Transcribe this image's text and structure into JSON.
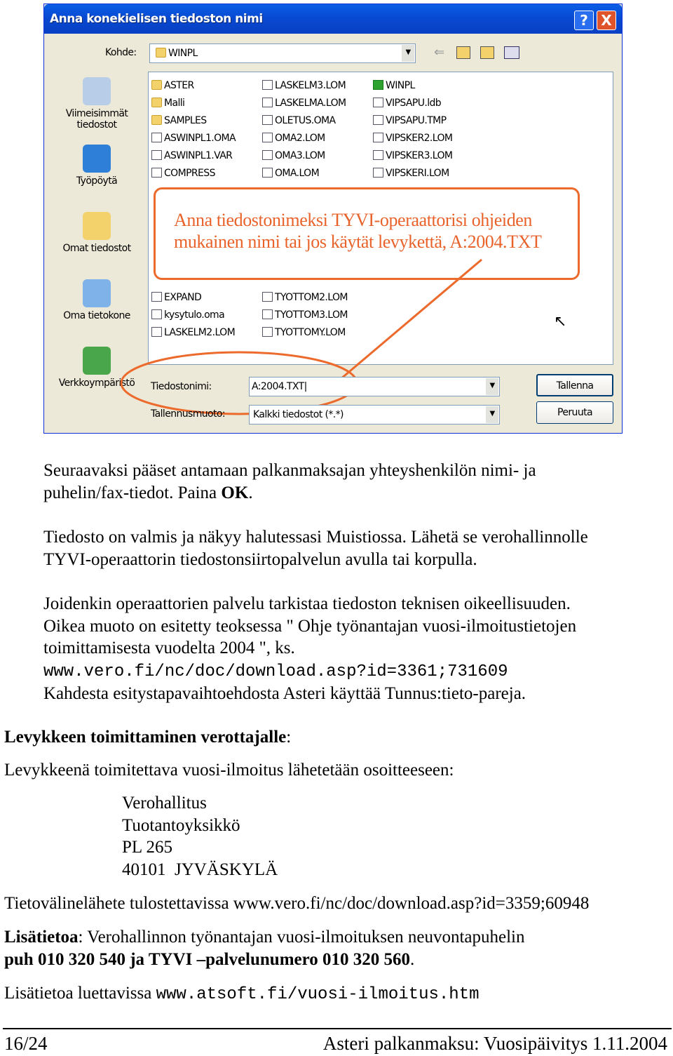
{
  "dialog": {
    "title": "Anna konekielisen tiedoston nimi",
    "help": "?",
    "close": "X",
    "location_label": "Kohde:",
    "location_value": "WINPL",
    "places": [
      "Viimeisimmät tiedostot",
      "Työpöytä",
      "Omat tiedostot",
      "Oma tietokone",
      "Verkkoympäristö"
    ],
    "files_col1": [
      "ASTER",
      "Malli",
      "SAMPLES",
      "ASWINPL1.OMA",
      "ASWINPL1.VAR",
      "COMPRESS"
    ],
    "files_col2": [
      "LASKELM3.LOM",
      "LASKELMA.LOM",
      "OLETUS.OMA",
      "OMA2.LOM",
      "OMA3.LOM",
      "OMA.LOM"
    ],
    "files_col3": [
      "WINPL",
      "VIPSAPU.ldb",
      "VIPSAPU.TMP",
      "VIPSKER2.LOM",
      "VIPSKER3.LOM",
      "VIPSKERI.LOM"
    ],
    "files_col1b": [
      "EXPAND",
      "kysytulo.oma",
      "LASKELM2.LOM"
    ],
    "files_col2b": [
      "TYOTTOM2.LOM",
      "TYOTTOM3.LOM",
      "TYOTTOMY.LOM"
    ],
    "filename_label": "Tiedostonimi:",
    "filename_value": "A:2004.TXT",
    "filetype_label": "Tallennusmuoto:",
    "filetype_value": "Kalkki tiedostot (*.*)",
    "save": "Tallenna",
    "cancel": "Peruuta",
    "callout": "Anna tiedostonimeksi TYVI-operaattorisi ohjeiden mukainen nimi tai jos käytät levykettä, A:2004.TXT",
    "accent": "#ec6a2c"
  },
  "text": {
    "p1a": "Seuraavaksi pääset antamaan palkanmaksajan yhteyshenkilön nimi- ja",
    "p1b": "puhelin/fax-tiedot. Paina ",
    "p1ok": "OK",
    "p2a": "Tiedosto on valmis ja näkyy halutessasi Muistiossa. Lähetä se verohallinnolle",
    "p2b": "TYVI-operaattorin tiedostonsiirtopalvelun avulla tai korpulla.",
    "p3a": "Joidenkin operaattorien palvelu tarkistaa tiedoston teknisen oikeellisuuden.",
    "p3b": "Oikea muoto on esitetty teoksessa \" Ohje työnantajan vuosi-ilmoitustietojen",
    "p3c": "toimittamisesta vuodelta 2004 \", ks.",
    "p3url": "www.vero.fi/nc/doc/download.asp?id=3361;731609",
    "p3d": "Kahdesta esitystapavaihtoehdosta Asteri käyttää Tunnus:tieto-pareja.",
    "h1": "Levykkeen toimittaminen verottajalle",
    "p4": "Levykkeenä toimitettava vuosi-ilmoitus lähetetään osoitteeseen:",
    "address": [
      "Verohallitus",
      "Tuotantoyksikkö",
      "PL 265",
      "40101  JYVÄSKYLÄ"
    ],
    "p5": "Tietovälinelähete tulostettavissa www.vero.fi/nc/doc/download.asp?id=3359;60948",
    "p6label": "Lisätietoa",
    "p6a": ": Verohallinnon työnantajan vuosi-ilmoituksen neuvontapuhelin",
    "p6b": "puh 010 320 540 ja TYVI –palvelunumero 010 320 560",
    "p7a": "Lisätietoa luettavissa ",
    "p7url": "www.atsoft.fi/vuosi-ilmoitus.htm"
  },
  "footer": {
    "page": "16/24",
    "title": "Asteri palkanmaksu: Vuosipäivitys 1.11.2004"
  }
}
